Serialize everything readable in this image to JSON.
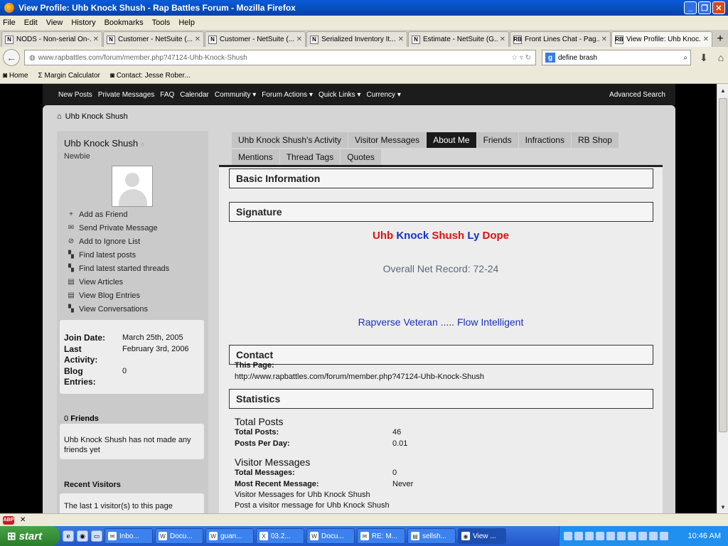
{
  "window": {
    "title": "View Profile: Uhb Knock Shush - Rap Battles Forum - Mozilla Firefox",
    "min": "_",
    "max": "❐",
    "close": "✕"
  },
  "menu": [
    "File",
    "Edit",
    "View",
    "History",
    "Bookmarks",
    "Tools",
    "Help"
  ],
  "tabs": [
    {
      "label": "NODS - Non-serial On-...",
      "icon": "N"
    },
    {
      "label": "Customer - NetSuite (...",
      "icon": "N"
    },
    {
      "label": "Customer - NetSuite (...",
      "icon": "N"
    },
    {
      "label": "Serialized Inventory It...",
      "icon": "N"
    },
    {
      "label": "Estimate - NetSuite (G...",
      "icon": "N"
    },
    {
      "label": "Front Lines Chat - Pag...",
      "icon": "RB"
    },
    {
      "label": "View Profile: Uhb Knoc...",
      "icon": "RB"
    }
  ],
  "nav": {
    "url_host": "www.rapbattles.com",
    "url_path": "/forum/member.php?47124-Uhb-Knock-Shush",
    "search": "define brash",
    "new_tab": "+"
  },
  "bookmarks": [
    "Home",
    "Margin Calculator",
    "Contact: Jesse Rober..."
  ],
  "site_nav": [
    "New Posts",
    "Private Messages",
    "FAQ",
    "Calendar",
    "Community ▾",
    "Forum Actions ▾",
    "Quick Links ▾",
    "Currency ▾"
  ],
  "advanced_search": "Advanced Search",
  "breadcrumb": "Uhb Knock Shush",
  "profile": {
    "name": "Uhb Knock Shush",
    "rank": "Newbie",
    "actions": [
      {
        "icon": "+",
        "label": "Add as Friend"
      },
      {
        "icon": "✉",
        "label": "Send Private Message"
      },
      {
        "icon": "⊘",
        "label": "Add to Ignore List"
      },
      {
        "icon": "▚",
        "label": "Find latest posts"
      },
      {
        "icon": "▚",
        "label": "Find latest started threads"
      },
      {
        "icon": "▤",
        "label": "View Articles"
      },
      {
        "icon": "▤",
        "label": "View Blog Entries"
      },
      {
        "icon": "▚",
        "label": "View Conversations"
      }
    ],
    "join_label": "Join Date:",
    "join_value": "March 25th, 2005",
    "last_label": "Last Activity:",
    "last_value": "February 3rd, 2006",
    "blog_label": "Blog Entries:",
    "blog_value": "0",
    "friends_count": "0",
    "friends_label": "Friends",
    "friends_text": "Uhb Knock Shush has not made any friends yet",
    "visitors_title": "Recent Visitors",
    "visitors_text": "The last 1 visitor(s) to this page"
  },
  "profile_tabs": [
    {
      "label": "Uhb Knock Shush's Activity",
      "active": false
    },
    {
      "label": "Visitor Messages",
      "active": false
    },
    {
      "label": "About Me",
      "active": true
    },
    {
      "label": "Friends",
      "active": false
    },
    {
      "label": "Infractions",
      "active": false
    },
    {
      "label": "RB Shop",
      "active": false
    },
    {
      "label": "Mentions",
      "active": false
    },
    {
      "label": "Thread Tags",
      "active": false
    },
    {
      "label": "Quotes",
      "active": false
    }
  ],
  "sections": {
    "basic": "Basic Information",
    "signature": "Signature",
    "contact": "Contact",
    "statistics": "Statistics"
  },
  "signature": {
    "words": [
      {
        "text": "Uhb",
        "color": "#e01010"
      },
      {
        "text": "Knock",
        "color": "#1530d0"
      },
      {
        "text": "Shush",
        "color": "#e01010"
      },
      {
        "text": "Ly",
        "color": "#1530d0"
      },
      {
        "text": "Dope",
        "color": "#e01010"
      }
    ],
    "record": "Overall Net Record: 72-24",
    "tagline": "Rapverse Veteran ..... Flow Intelligent"
  },
  "contact": {
    "label": "This Page:",
    "url": "http://www.rapbattles.com/forum/member.php?47124-Uhb-Knock-Shush"
  },
  "stats": {
    "posts_heading": "Total Posts",
    "total_posts_label": "Total Posts:",
    "total_posts": "46",
    "ppd_label": "Posts Per Day:",
    "ppd": "0.01",
    "vm_heading": "Visitor Messages",
    "total_msgs_label": "Total Messages:",
    "total_msgs": "0",
    "recent_label": "Most Recent Message:",
    "recent": "Never",
    "vm_link": "Visitor Messages for Uhb Knock Shush",
    "post_vm_link": "Post a visitor message for Uhb Knock Shush"
  },
  "taskbar": {
    "start": "start",
    "tasks": [
      "Inbo...",
      "Docu...",
      "guan...",
      "03.2...",
      "Docu...",
      "RE: M...",
      "sellsh...",
      "View ..."
    ],
    "clock": "10:46 AM"
  }
}
